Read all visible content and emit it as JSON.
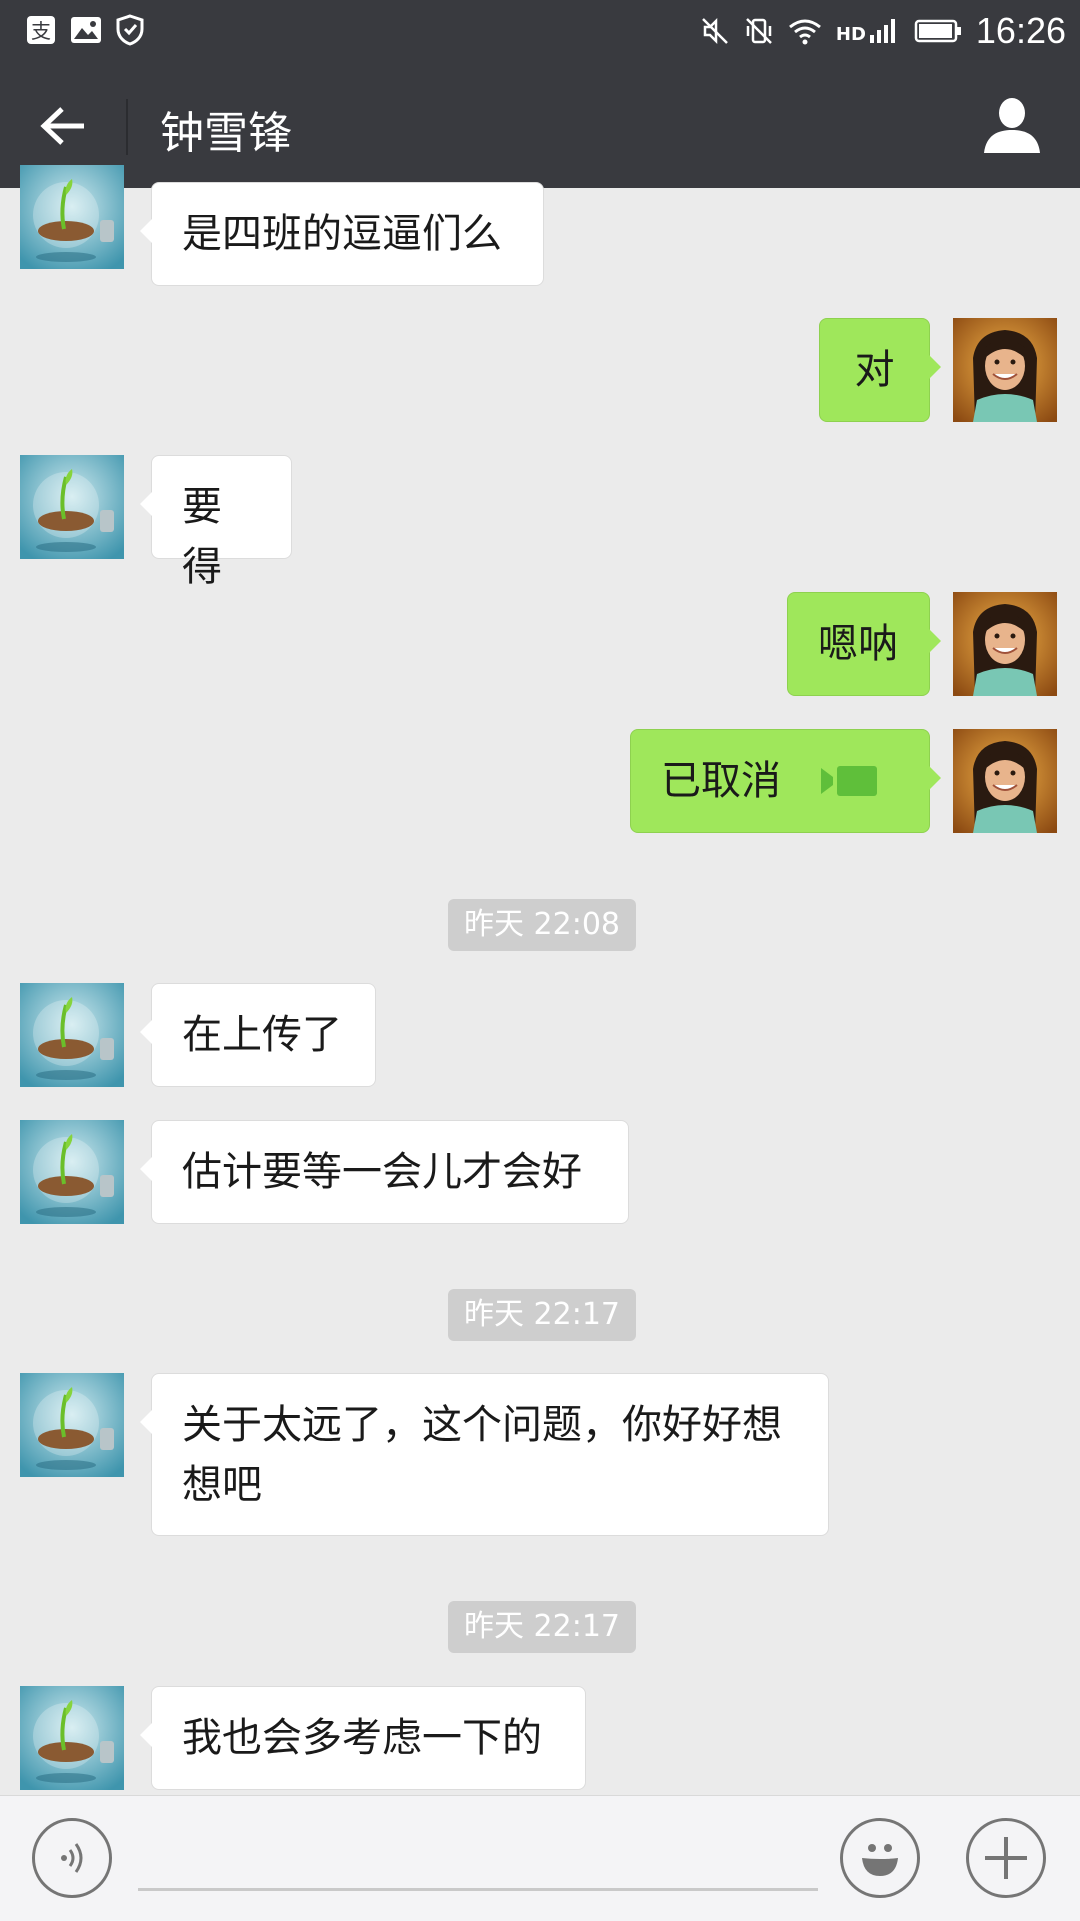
{
  "status_bar": {
    "time": "16:26",
    "network": "HD",
    "left_icons": [
      "alipay-icon",
      "image-icon",
      "shield-icon"
    ],
    "right_icons": [
      "mute-icon",
      "vibrate-off-icon",
      "wifi-icon",
      "signal-icon",
      "battery-icon"
    ]
  },
  "title_bar": {
    "title": "钟雪锋",
    "back_icon": "arrow-left-icon",
    "profile_icon": "person-icon"
  },
  "messages": [
    {
      "side": "left",
      "text": "是四班的逗逼们么"
    },
    {
      "side": "right",
      "text": "对"
    },
    {
      "side": "left",
      "text": "要得"
    },
    {
      "side": "right",
      "text": "嗯呐"
    },
    {
      "side": "right",
      "text": "已取消",
      "icon": "video-call-icon"
    },
    {
      "type": "timestamp",
      "text": "昨天 22:08"
    },
    {
      "side": "left",
      "text": "在上传了"
    },
    {
      "side": "left",
      "text": "估计要等一会儿才会好"
    },
    {
      "type": "timestamp",
      "text": "昨天 22:17"
    },
    {
      "side": "left",
      "text": "关于太远了，这个问题，你好好想想吧"
    },
    {
      "type": "timestamp",
      "text": "昨天 22:17"
    },
    {
      "side": "left",
      "text": "我也会多考虑一下的"
    }
  ],
  "input_bar": {
    "voice_icon": "voice-icon",
    "emoji_icon": "emoji-icon",
    "plus_icon": "plus-icon"
  },
  "colors": {
    "header": "#393a3f",
    "background": "#ebebeb",
    "sent_bubble": "#9fe75b",
    "received_bubble": "#ffffff",
    "timestamp_bg": "#cecece"
  }
}
